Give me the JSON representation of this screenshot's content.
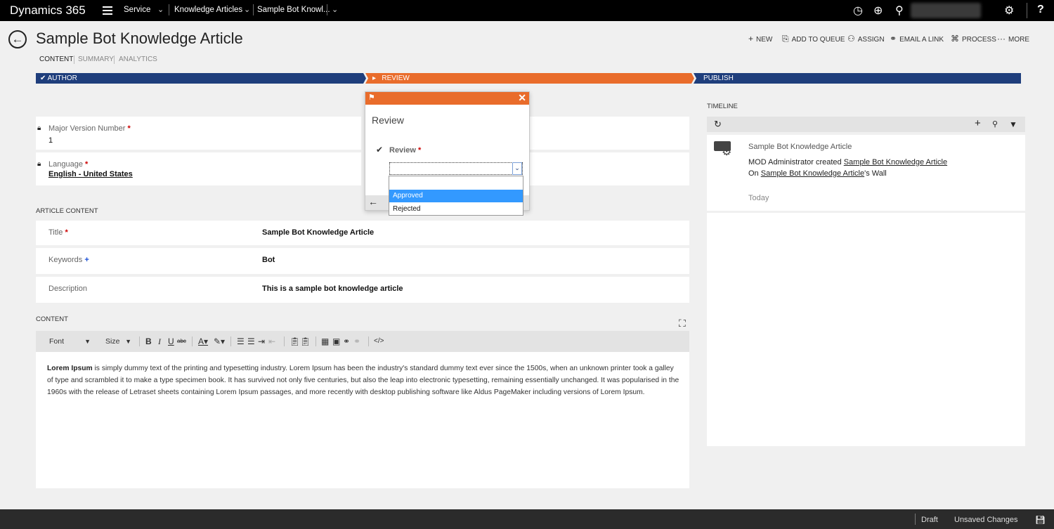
{
  "topnav": {
    "brand": "Dynamics 365",
    "breadcrumbs": [
      "Service",
      "Knowledge Articles",
      "Sample Bot Knowl..."
    ],
    "icons": [
      "history-icon",
      "new-icon",
      "search-icon",
      "settings-icon",
      "help-icon"
    ]
  },
  "header": {
    "title": "Sample Bot Knowledge Article",
    "commands": [
      "NEW",
      "ADD TO QUEUE",
      "ASSIGN",
      "EMAIL A LINK",
      "PROCESS",
      "MORE"
    ],
    "command_glyphs": [
      "+",
      "⎘",
      "⚇",
      "⚭",
      "⌘",
      "···"
    ],
    "tabs": [
      "CONTENT",
      "SUMMARY",
      "ANALYTICS"
    ]
  },
  "process": {
    "stages": [
      "AUTHOR",
      "REVIEW",
      "PUBLISH"
    ],
    "stage_glyphs": [
      "✔",
      "▸",
      ""
    ],
    "colors": {
      "completed": "#1f3e7c",
      "active": "#e96c2b"
    }
  },
  "fields": {
    "major_version_label": "Major Version Number",
    "major_version_value": "1",
    "language_label": "Language",
    "language_value": "English - United States",
    "required_mark": "*",
    "recommended_mark": "+"
  },
  "article_content": {
    "section": "ARTICLE CONTENT",
    "title_label": "Title",
    "title_value": "Sample Bot Knowledge Article",
    "keywords_label": "Keywords",
    "keywords_value": "Bot",
    "description_label": "Description",
    "description_value": "This is a sample bot knowledge article"
  },
  "content": {
    "section": "CONTENT",
    "font_combo": "Font",
    "size_combo": "Size",
    "text_lead": "Lorem Ipsum",
    "text_rest": " is simply dummy text of the printing and typesetting industry. Lorem Ipsum has been the industry's standard dummy text ever since the 1500s, when an unknown printer took a galley of type and scrambled it to make a type specimen book. It has survived not only five centuries, but also the leap into electronic typesetting, remaining essentially unchanged. It was popularised in the 1960s with the release of Letraset sheets containing Lorem Ipsum passages, and more recently with desktop publishing software like Aldus PageMaker including versions of Lorem Ipsum."
  },
  "timeline": {
    "label": "TIMELINE",
    "post_title": "Sample Bot Knowledge Article",
    "post_line1_prefix": "MOD Administrator created ",
    "post_line1_link": "Sample Bot Knowledge Article",
    "post_line2_prefix": "On ",
    "post_line2_link": "Sample Bot Knowledge Article",
    "post_line2_suffix": "'s Wall",
    "post_time": "Today"
  },
  "review_flyout": {
    "title": "Review",
    "field_label": "Review",
    "select_value": "",
    "options": [
      "",
      "Approved",
      "Rejected"
    ],
    "highlighted_option": "Approved"
  },
  "footer": {
    "status": "Draft",
    "save_state": "Unsaved Changes"
  }
}
